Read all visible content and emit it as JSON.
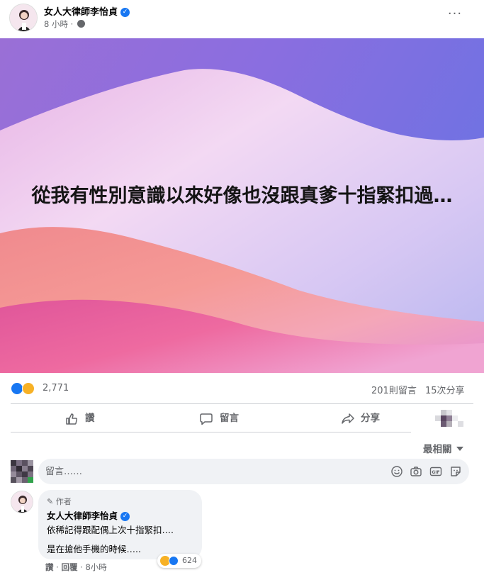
{
  "post": {
    "author": "女人大律師李怡貞",
    "time": "8 小時 ·",
    "more_label": "···",
    "image_text": "從我有性別意識以來好像也沒跟真爹十指緊扣過…"
  },
  "stats": {
    "reaction_count": "2,771",
    "comment_count": "201則留言",
    "share_count": "15次分享"
  },
  "actions": {
    "like": "讚",
    "comment": "留言",
    "share": "分享"
  },
  "comments_section": {
    "sort_label": "最相關",
    "composer_placeholder": "留言……"
  },
  "comment": {
    "author_tag": "作者",
    "author": "女人大律師李怡貞",
    "line1": "依稀記得跟配偶上次十指緊扣….",
    "line2": "是在搶他手機的時候…..",
    "reaction_count": "624",
    "like_label": "讚",
    "reply_label": "回覆",
    "time": "8小時"
  },
  "icons": {
    "verified": "verified-check-icon",
    "privacy": "globe-icon",
    "like": "thumbs-up-icon",
    "comment": "speech-bubble-icon",
    "share": "share-arrow-icon",
    "emoji": "emoji-icon",
    "camera": "camera-icon",
    "gif": "gif-icon",
    "sticker": "sticker-icon"
  },
  "colors": {
    "brand_blue": "#1877f2",
    "muted_text": "#65676b",
    "bubble_bg": "#f0f2f5"
  }
}
